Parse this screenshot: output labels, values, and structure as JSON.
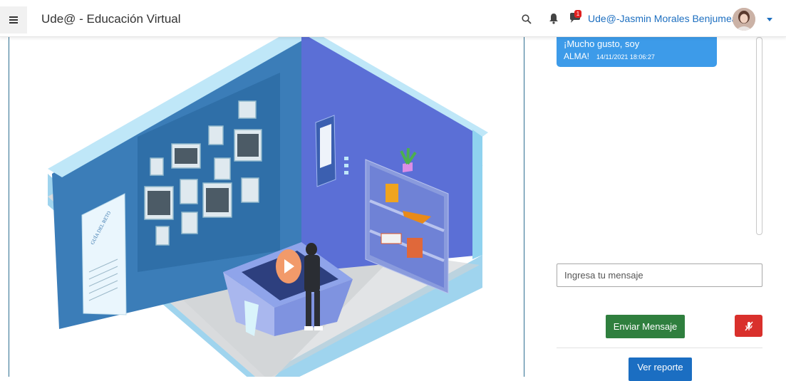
{
  "navbar": {
    "brand": "Ude@ - Educación Virtual",
    "user_name": "Ude@-Jasmin Morales Benjumea",
    "message_badge": "1",
    "icons": [
      "menu-icon",
      "search-icon",
      "bell-icon",
      "chat-icon",
      "avatar",
      "caret-down-icon"
    ]
  },
  "scene": {
    "guide_title": "GUÍA DEL RETO"
  },
  "chat": {
    "bubble_line1": "¡Mucho gusto, soy",
    "bubble_line2": "ALMA!",
    "bubble_time": "14/11/2021 18:06:27",
    "input_placeholder": "Ingresa tu mensaje",
    "send_label": "Enviar Mensaje",
    "report_label": "Ver reporte"
  },
  "colors": {
    "accent_blue": "#1b6ec2",
    "bubble_blue": "#3d9be9",
    "send_green": "#2f7f3e",
    "mic_red": "#d9302c",
    "room_wall_left": "#3b7db8",
    "room_wall_right": "#5b6fd6"
  }
}
